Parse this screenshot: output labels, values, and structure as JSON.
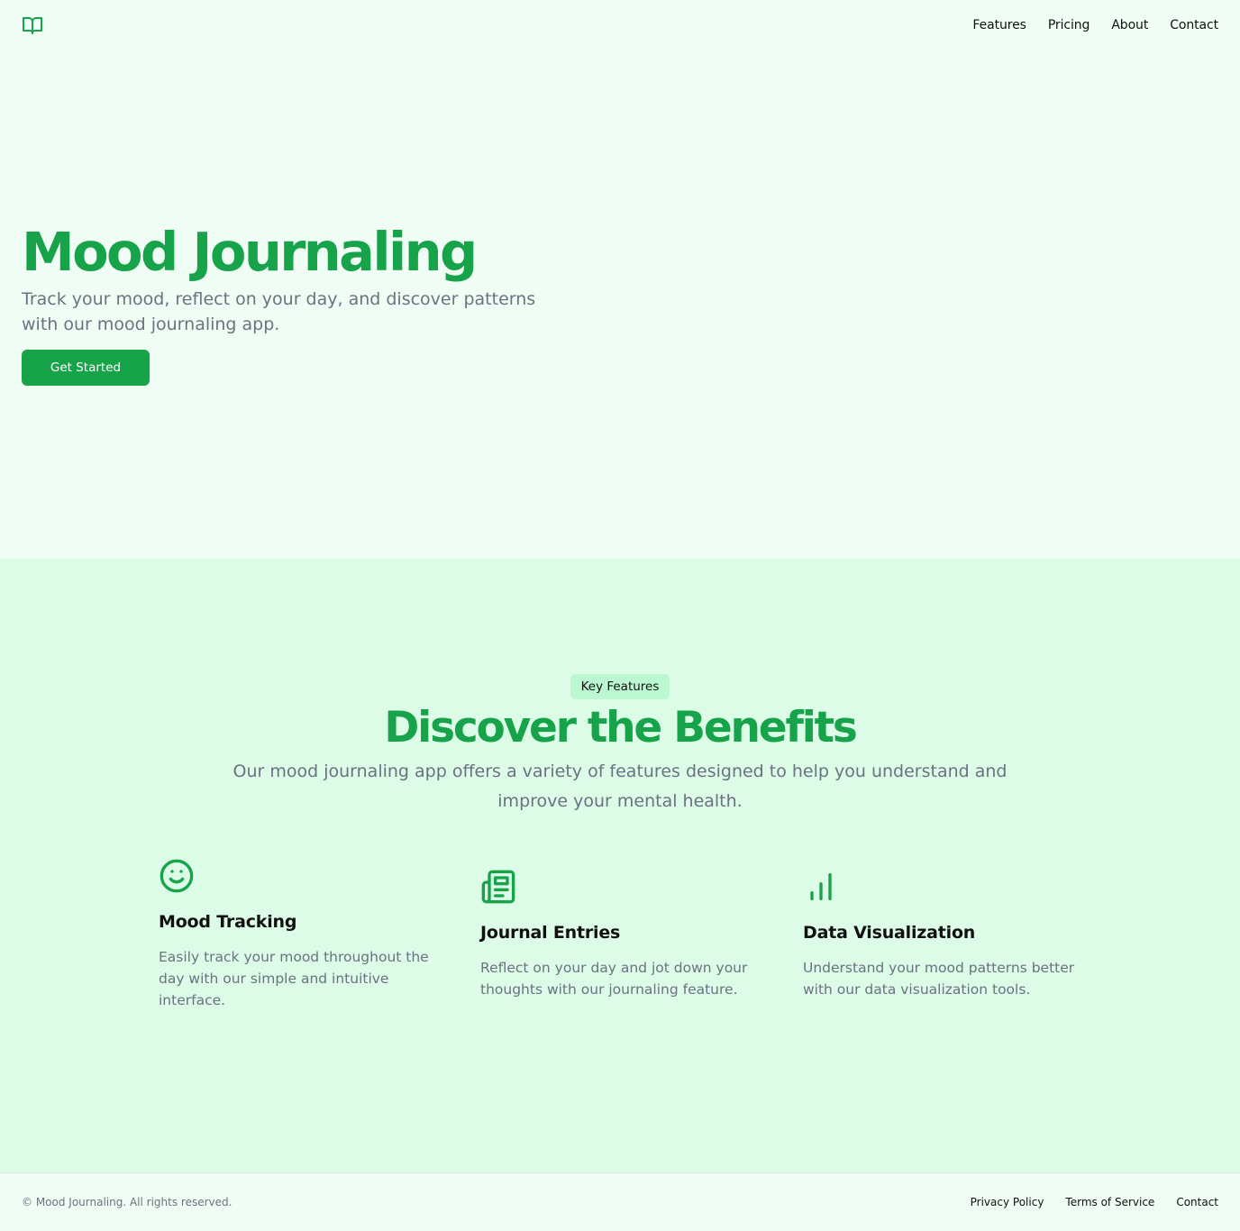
{
  "header": {
    "logo_icon": "book-open-icon",
    "nav": [
      {
        "label": "Features"
      },
      {
        "label": "Pricing"
      },
      {
        "label": "About"
      },
      {
        "label": "Contact"
      }
    ]
  },
  "hero": {
    "title": "Mood Journaling",
    "subtitle": "Track your mood, reflect on your day, and discover patterns with our mood journaling app.",
    "cta_label": "Get Started"
  },
  "features": {
    "badge": "Key Features",
    "title": "Discover the Benefits",
    "subtitle": "Our mood journaling app offers a variety of features designed to help you understand and improve your mental health.",
    "items": [
      {
        "icon": "smile-icon",
        "title": "Mood Tracking",
        "description": "Easily track your mood throughout the day with our simple and intuitive interface."
      },
      {
        "icon": "newspaper-icon",
        "title": "Journal Entries",
        "description": "Reflect on your day and jot down your thoughts with our journaling feature."
      },
      {
        "icon": "bar-chart-icon",
        "title": "Data Visualization",
        "description": "Understand your mood patterns better with our data visualization tools."
      }
    ]
  },
  "footer": {
    "copyright": "© Mood Journaling. All rights reserved.",
    "links": [
      {
        "label": "Privacy Policy"
      },
      {
        "label": "Terms of Service"
      },
      {
        "label": "Contact"
      }
    ]
  },
  "colors": {
    "brand": "#16a34a",
    "hero_bg": "#f0fdf4",
    "features_bg": "#dcfce7",
    "badge_bg": "#bbf7d0",
    "muted_text": "#6b7280"
  }
}
